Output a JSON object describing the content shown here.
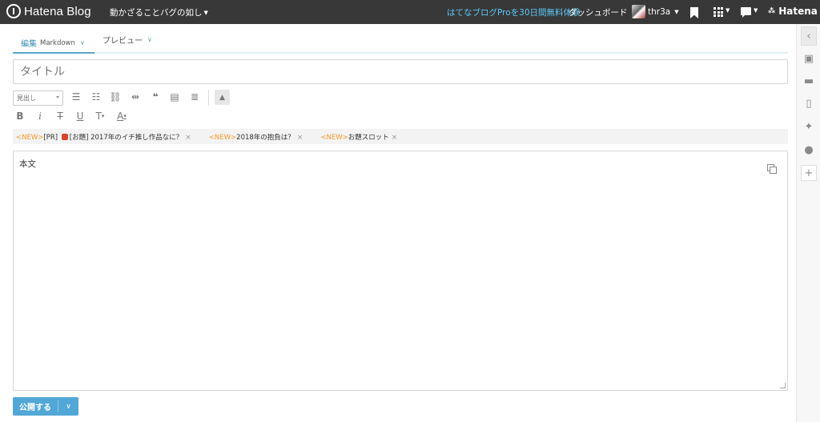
{
  "header": {
    "brand": "Hatena Blog",
    "blog_name": "動かざることバグの如し",
    "pro_link": "はてなブログProを30日間無料体験",
    "dashboard": "ダッシュボード",
    "username": "thr3a",
    "hatena": "Hatena"
  },
  "tabs": {
    "edit": "編集",
    "edit_mode": "Markdown",
    "preview": "プレビュー"
  },
  "title_field": {
    "placeholder": "タイトル"
  },
  "toolbar": {
    "heading": "見出し",
    "bold": "B",
    "italic": "i",
    "strike": "T",
    "underline": "U",
    "fontsize": "T",
    "color": "A"
  },
  "topics": [
    {
      "new": "<NEW>",
      "text": "[PR] ",
      "text2": "[お題] 2017年のイチ推し作品なに？"
    },
    {
      "new": "<NEW>",
      "text": "2018年の抱負は？"
    },
    {
      "new": "<NEW>",
      "text": "お題スロット"
    }
  ],
  "body_field": {
    "placeholder": "本文"
  },
  "publish": {
    "label": "公開する"
  },
  "icons": {
    "close": "×",
    "chevron": "⌄"
  }
}
